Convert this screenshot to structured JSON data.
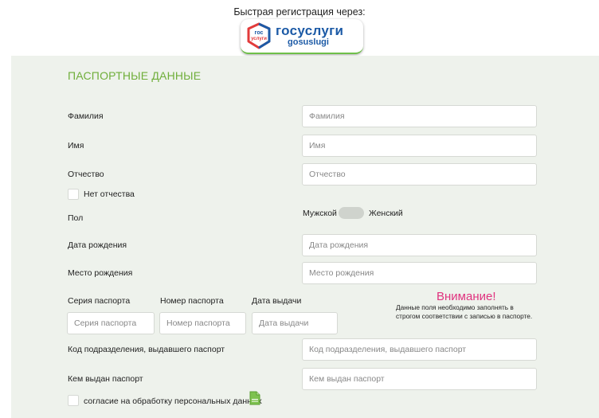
{
  "header": {
    "label": "Быстрая регистрация через:",
    "gos_button": {
      "name": "госуслуги",
      "latin": "gosuslugi",
      "mark_top": "гос",
      "mark_bottom": "услуги"
    }
  },
  "section_title": "ПАСПОРТНЫЕ ДАННЫЕ",
  "fields": {
    "last_name": {
      "label": "Фамилия",
      "placeholder": "Фамилия"
    },
    "first_name": {
      "label": "Имя",
      "placeholder": "Имя"
    },
    "patronymic": {
      "label": "Отчество",
      "placeholder": "Отчество"
    },
    "no_patronymic_label": "Нет отчества",
    "gender": {
      "label": "Пол",
      "male": "Мужской",
      "female": "Женский"
    },
    "birth_date": {
      "label": "Дата рождения",
      "placeholder": "Дата рождения"
    },
    "birth_place": {
      "label": "Место рождения",
      "placeholder": "Место рождения"
    },
    "passport_series": {
      "label": "Серия паспорта",
      "placeholder": "Серия паспорта"
    },
    "passport_number": {
      "label": "Номер паспорта",
      "placeholder": "Номер паспорта"
    },
    "issue_date": {
      "label": "Дата выдачи",
      "placeholder": "Дата выдачи"
    },
    "division_code": {
      "label": "Код подразделения, выдавшего паспорт",
      "placeholder": "Код подразделения, выдавшего паспорт"
    },
    "issued_by": {
      "label": "Кем выдан паспорт",
      "placeholder": "Кем выдан паспорт"
    },
    "consent_label": "согласие на обработку персональных данных"
  },
  "warning": {
    "title": "Внимание!",
    "text": "Данные поля необходимо заполнять в строгом соответствии с записью в паспорте."
  },
  "colors": {
    "accent_green": "#6fae3a",
    "warning_pink": "#e0337f",
    "brand_blue": "#1c5aa6",
    "brand_red": "#e23b3b"
  }
}
